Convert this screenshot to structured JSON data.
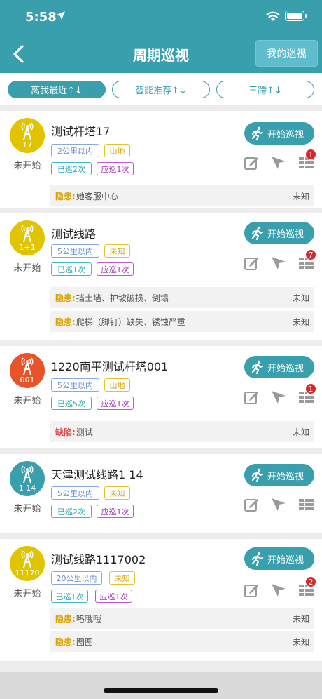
{
  "status_bar": {
    "time": "5:58"
  },
  "nav": {
    "title": "周期巡视",
    "my_patrol": "我的巡视"
  },
  "filters": [
    "离我最近↑↓",
    "智能推荐↑↓",
    "三跨↑↓"
  ],
  "labels": {
    "start": "开始巡视",
    "hidden_danger": "隐患:",
    "defect": "缺陷:"
  },
  "colors": {
    "primary": "#3a9fad",
    "yellow": "#e0c400",
    "red": "#e8532a",
    "teal": "#3a9fad",
    "badge": "#d7282e"
  },
  "cards": [
    {
      "name": "测试杆塔17",
      "avatar_text": "17",
      "state": "未开始",
      "distance": "2公里以内",
      "terrain": "山地",
      "done": "已巡2次",
      "should": "应巡1次",
      "badge": "1",
      "rows": [
        {
          "type": "隐患:",
          "text": "她客服中心",
          "status": "未知"
        }
      ]
    },
    {
      "name": "测试线路",
      "avatar_text": "1+1",
      "state": "未开始",
      "distance": "5公里以内",
      "terrain": "未知",
      "done": "已巡1次",
      "should": "应巡1次",
      "badge": "7",
      "rows": [
        {
          "type": "隐患:",
          "text": "挡土墙、护坡破损、倒塌",
          "status": "未知"
        },
        {
          "type": "隐患:",
          "text": "爬梯（脚钉）缺失、锈蚀严重",
          "status": "未知"
        }
      ]
    },
    {
      "name": "1220南平测试杆塔001",
      "avatar_text": "001",
      "state": "未开始",
      "distance": "5公里以内",
      "terrain": "山地",
      "done": "已巡5次",
      "should": "应巡1次",
      "badge": "1",
      "rows": [
        {
          "type": "缺陷:",
          "text": "测试",
          "status": "未知"
        }
      ]
    },
    {
      "name": "天津测试线路1 14",
      "avatar_text": "1 14",
      "state": "未开始",
      "distance": "5公里以内",
      "terrain": "未知",
      "done": "已巡2次",
      "should": "应巡1次",
      "badge": "",
      "rows": []
    },
    {
      "name": "测试线路1117002",
      "avatar_text": "11170",
      "state": "未开始",
      "distance": "20公里以内",
      "terrain": "未知",
      "done": "已巡1次",
      "should": "应巡1次",
      "badge": "2",
      "rows": [
        {
          "type": "隐患:",
          "text": "咯哦哦",
          "status": "未知"
        },
        {
          "type": "隐患:",
          "text": "图图",
          "status": "未知"
        }
      ]
    }
  ]
}
